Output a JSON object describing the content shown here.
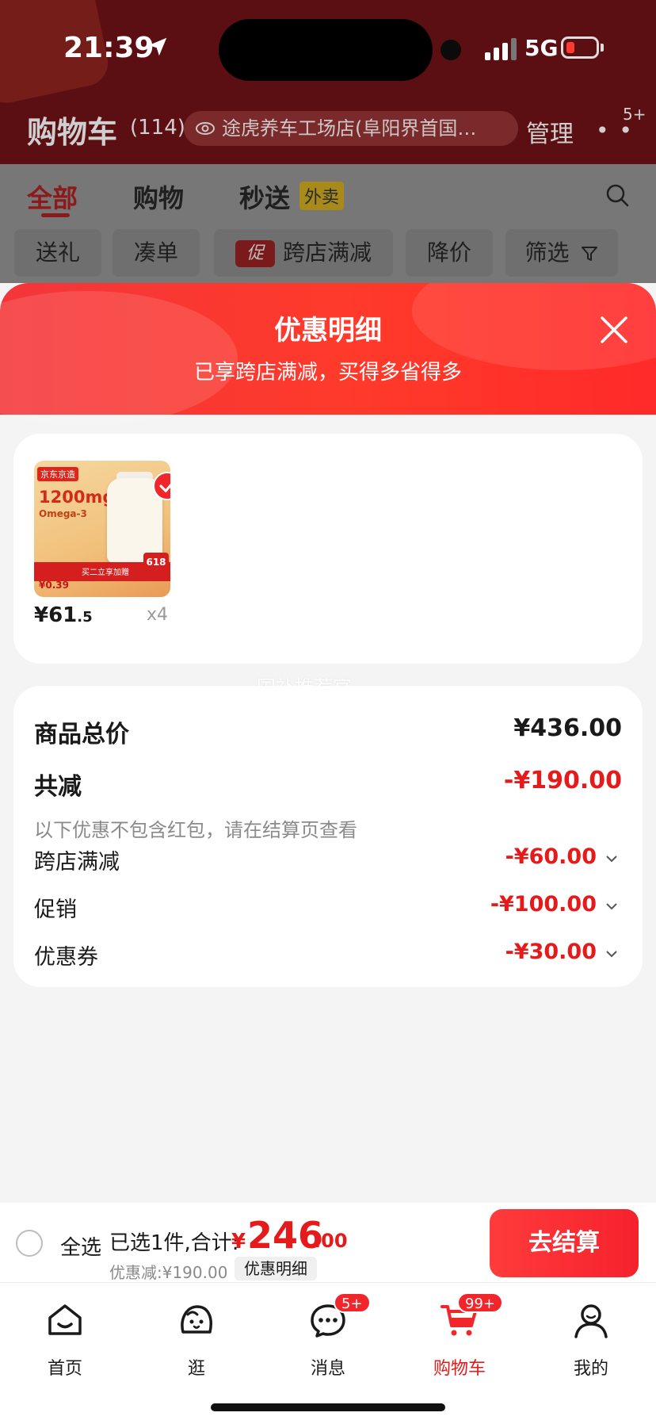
{
  "status_bar": {
    "time": "21:39",
    "network": "5G"
  },
  "cart_header": {
    "title": "购物车",
    "count": "(114)",
    "store": "途虎养车工场店(阜阳界首国…",
    "manage": "管理",
    "more_badge": "5+"
  },
  "tabs": [
    {
      "label": "全部"
    },
    {
      "label": "购物"
    },
    {
      "label": "秒送"
    }
  ],
  "waimai_badge": "外卖",
  "filter_chips": [
    {
      "label": "送礼"
    },
    {
      "label": "凑单"
    },
    {
      "label": "跨店满减",
      "badge": "促"
    },
    {
      "label": "降价"
    },
    {
      "label": "筛选"
    }
  ],
  "sheet": {
    "title": "优惠明细",
    "subtitle": "已享跨店满减，买得多省得多"
  },
  "product": {
    "image_text": {
      "brand": "京东京造",
      "dose": "1200mg",
      "name": "Omega-3",
      "tag": "618",
      "band": "买二立享加赠",
      "mini_price": "¥0.39"
    },
    "price_int": "¥61",
    "price_dec": ".5",
    "quantity": "x4"
  },
  "watermark": "国补推荐官",
  "summary": {
    "total_label": "商品总价",
    "total_value": "¥436.00",
    "reduce_label": "共减",
    "reduce_value": "-¥190.00",
    "note": "以下优惠不包含红包，请在结算页查看",
    "items": [
      {
        "label": "跨店满减",
        "value": "-¥60.00"
      },
      {
        "label": "促销",
        "value": "-¥100.00"
      },
      {
        "label": "优惠券",
        "value": "-¥30.00"
      }
    ]
  },
  "checkout": {
    "select_all": "全选",
    "selected_text": "已选1件,合计:",
    "total_yen": "¥",
    "total_int": "246",
    "total_dec": ".00",
    "discount_line": "优惠减:¥190.00",
    "detail_chip": "优惠明细",
    "button": "去结算"
  },
  "nav": [
    {
      "label": "首页",
      "icon": "home-icon"
    },
    {
      "label": "逛",
      "icon": "explore-icon"
    },
    {
      "label": "消息",
      "icon": "message-icon",
      "badge": "5+"
    },
    {
      "label": "购物车",
      "icon": "cart-icon",
      "badge": "99+",
      "active": true
    },
    {
      "label": "我的",
      "icon": "profile-icon"
    }
  ],
  "colors": {
    "accent": "#e61a1a",
    "header_red": "#f4363a"
  }
}
